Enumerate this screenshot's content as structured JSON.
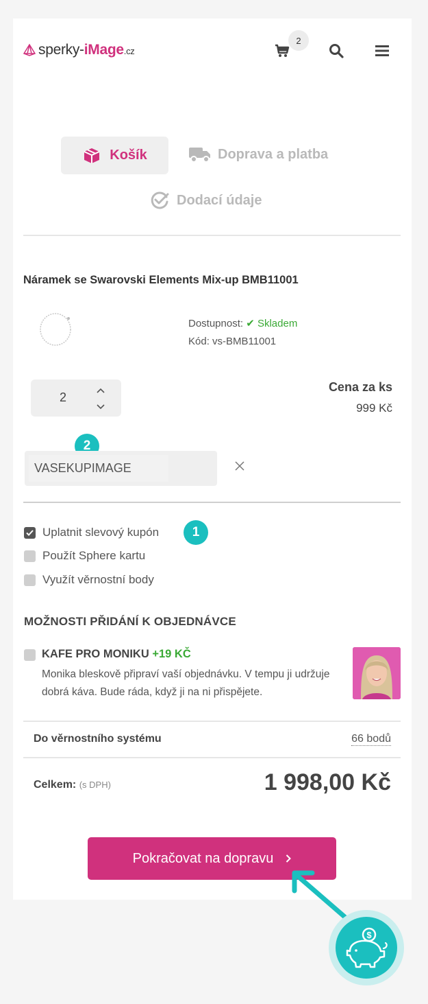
{
  "header": {
    "logo_prefix": "sperky-",
    "logo_highlight": "iMage",
    "logo_suffix": ".cz",
    "cart_count": "2"
  },
  "steps": {
    "cart": "Košík",
    "shipping": "Doprava a platba",
    "delivery": "Dodací údaje"
  },
  "product": {
    "title": "Náramek se Swarovski Elements Mix-up BMB11001",
    "availability_label": "Dostupnost:",
    "availability_value": "Skladem",
    "code_label": "Kód: vs-BMB11001",
    "quantity": "2",
    "price_label": "Cena za ks",
    "price_value": "999 Kč"
  },
  "coupon": {
    "value": "VASEKUPIMAGE",
    "badge": "2"
  },
  "options": {
    "apply_coupon": "Uplatnit slevový kupón",
    "apply_coupon_badge": "1",
    "sphere_card": "Použít Sphere kartu",
    "loyalty_points": "Využít věrnostní body"
  },
  "addons": {
    "section_title": "MOŽNOSTI PŘIDÁNÍ K OBJEDNÁVCE",
    "item_title": "KAFE PRO MONIKU",
    "item_price": "+19 KČ",
    "item_desc": "Monika bleskově připraví vaší objednávku. V tempu ji udržuje dobrá káva. Bude ráda, když ji na ni přispějete."
  },
  "summary": {
    "loyalty_label": "Do věrnostního systému",
    "loyalty_points": "66 bodů",
    "total_label": "Celkem:",
    "total_note": "(s DPH)",
    "total_value": "1 998,00 Kč"
  },
  "cta": {
    "label": "Pokračovat na dopravu"
  },
  "colors": {
    "brand": "#d0317d",
    "accent": "#1bbfbf",
    "success": "#3aa935"
  }
}
